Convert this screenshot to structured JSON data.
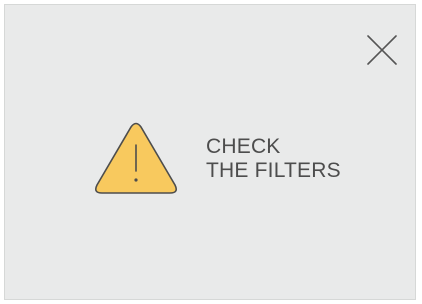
{
  "alert": {
    "message_line_1": "CHECK",
    "message_line_2": "THE FILTERS",
    "icon": "warning-triangle-icon",
    "close_icon": "close-icon"
  },
  "colors": {
    "panel_background": "#e9eaea",
    "text": "#4d4d4d",
    "warning_fill": "#f8c95e",
    "warning_stroke": "#4d4d4d",
    "close_stroke": "#555555",
    "accent": "#3a9ac4"
  }
}
